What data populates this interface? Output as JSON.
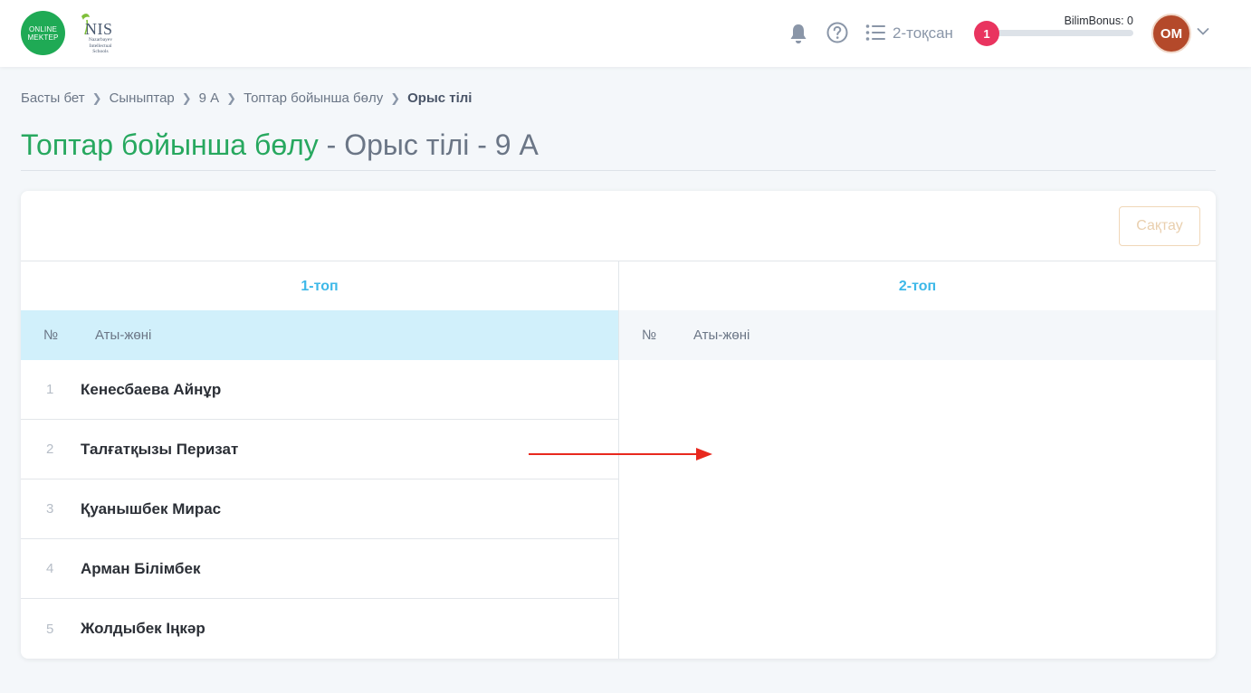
{
  "header": {
    "logo_online_top": "ONLINE",
    "logo_online_bottom": "MEKTEP",
    "logo_nis_word": "NIS",
    "logo_nis_sub": "Nazarbayev Intellectual Schools",
    "quarter_label": "2-тоқсан",
    "bonus_label": "BilimBonus: 0",
    "bonus_badge": "1",
    "avatar_initials": "ОМ",
    "icons": [
      "bell-icon",
      "help-icon",
      "list-icon",
      "chevron-down-icon"
    ]
  },
  "breadcrumb": {
    "items": [
      "Басты бет",
      "Сыныптар",
      "9 А",
      "Топтар бойынша бөлу"
    ],
    "current": "Орыс тілі"
  },
  "title": {
    "main": "Топтар бойынша бөлу",
    "rest": " - Орыс тілі - 9 А"
  },
  "card": {
    "save_label": "Сақтау",
    "groups": [
      {
        "title": "1-топ",
        "columns": [
          "№",
          "Аты-жөні"
        ],
        "students": [
          {
            "num": "1",
            "name": "Кенесбаева Айнұр"
          },
          {
            "num": "2",
            "name": "Талғатқызы Перизат"
          },
          {
            "num": "3",
            "name": "Қуанышбек Мирас"
          },
          {
            "num": "4",
            "name": "Арман Білімбек"
          },
          {
            "num": "5",
            "name": "Жолдыбек Іңкәр"
          }
        ]
      },
      {
        "title": "2-топ",
        "columns": [
          "№",
          "Аты-жөні"
        ],
        "students": []
      }
    ]
  },
  "colors": {
    "brand_green": "#27a85f",
    "group_title_blue": "#3db8e8",
    "highlight_header": "#d1f0fb",
    "badge_red": "#e9345f",
    "arrow_red": "#e8281e"
  }
}
